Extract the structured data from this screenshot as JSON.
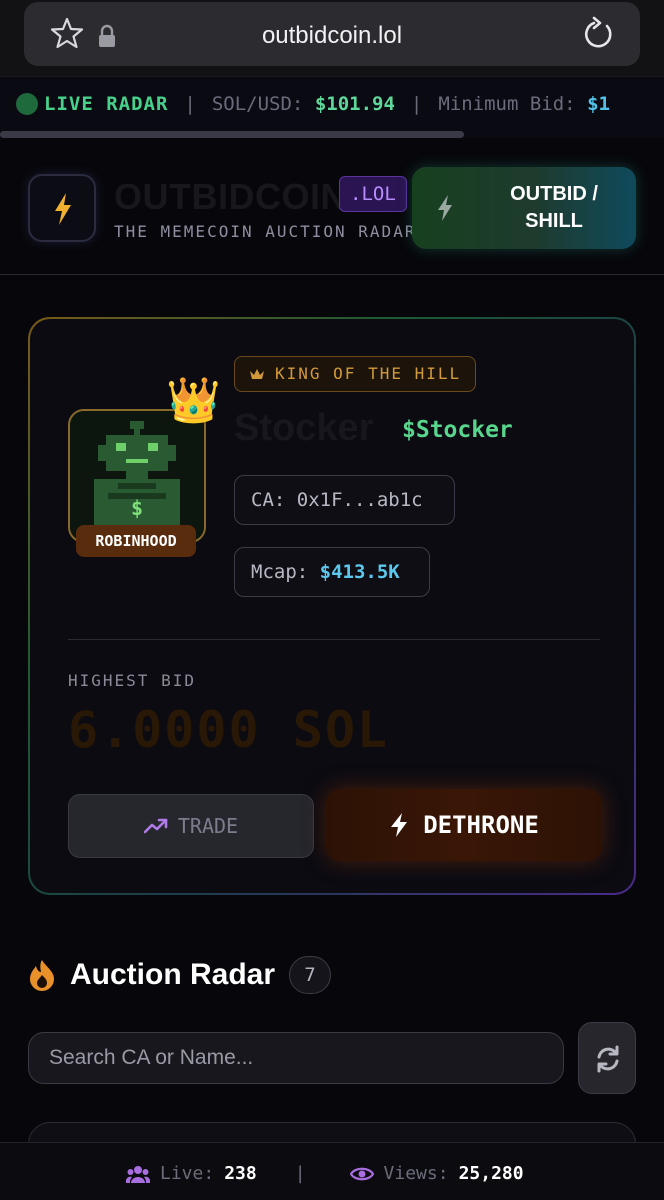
{
  "browser": {
    "url": "outbidcoin.lol",
    "icons": {
      "star": "star-icon",
      "lock": "lock-icon",
      "reload": "reload-icon"
    }
  },
  "ticker": {
    "live_label": "LIVE RADAR",
    "separator": "|",
    "price_label": "SOL/USD:",
    "price_value": "$101.94",
    "min_bid_label": "Minimum Bid:",
    "min_bid_value": "$1"
  },
  "header": {
    "brand": "OUTBIDCOIN",
    "badge": ".LOL",
    "tagline": "THE MEMECOIN AUCTION RADAR",
    "outbid_button": "OUTBID / SHILL"
  },
  "king": {
    "badge": "KING OF THE HILL",
    "crown_emoji": "👑",
    "avatar_badge": "ROBINHOOD",
    "name": "Stocker",
    "ticker": "$Stocker",
    "ca_label": "CA:",
    "ca_value": "0x1F...ab1c",
    "mcap_label": "Mcap:",
    "mcap_value": "$413.5K",
    "highest_bid_label": "HIGHEST BID",
    "highest_bid_value": "6.0000 SOL",
    "trade_label": "TRADE",
    "dethrone_label": "DETHRONE"
  },
  "radar": {
    "title": "Auction Radar",
    "count": "7",
    "search_placeholder": "Search CA or Name..."
  },
  "footer": {
    "live_label": "Live:",
    "live_value": "238",
    "separator": "|",
    "views_label": "Views:",
    "views_value": "25,280"
  },
  "colors": {
    "accent_green": "#47d18b",
    "accent_blue": "#52c2e8",
    "accent_purple": "#b88cff",
    "gold": "#d29a3a",
    "background": "#07070b"
  }
}
